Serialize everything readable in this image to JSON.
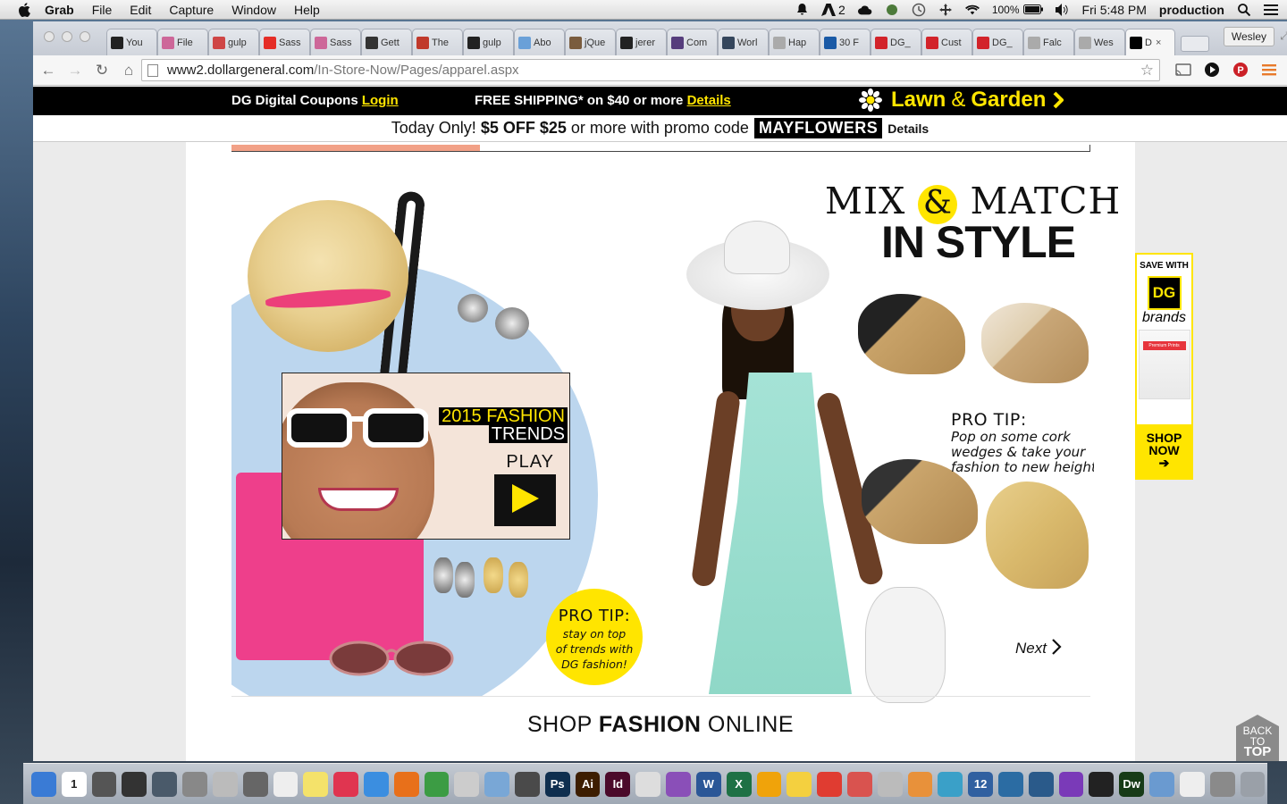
{
  "menubar": {
    "app": "Grab",
    "items": [
      "File",
      "Edit",
      "Capture",
      "Window",
      "Help"
    ],
    "adobe_count": "2",
    "battery": "100%",
    "clock": "Fri 5:48 PM",
    "user": "production"
  },
  "browser": {
    "tabs": [
      {
        "label": "You",
        "icon": "github-icon",
        "color": "#222222"
      },
      {
        "label": "File",
        "icon": "sass-icon",
        "color": "#cd6799"
      },
      {
        "label": "gulp",
        "icon": "gulp-icon",
        "color": "#cf4646"
      },
      {
        "label": "Sass",
        "icon": "youtube-icon",
        "color": "#e52d27"
      },
      {
        "label": "Sass",
        "icon": "sass-icon",
        "color": "#cd6799"
      },
      {
        "label": "Gett",
        "icon": "circle-icon",
        "color": "#333333"
      },
      {
        "label": "The",
        "icon": "zend-icon",
        "color": "#c0392b"
      },
      {
        "label": "gulp",
        "icon": "github-icon",
        "color": "#222222"
      },
      {
        "label": "Abo",
        "icon": "bird-icon",
        "color": "#6aa0d8"
      },
      {
        "label": "jQue",
        "icon": "photo-icon",
        "color": "#7a5c3e"
      },
      {
        "label": "jerer",
        "icon": "github-icon",
        "color": "#222222"
      },
      {
        "label": "Com",
        "icon": "bootstrap-icon",
        "color": "#563d7c"
      },
      {
        "label": "Worl",
        "icon": "tumblr-icon",
        "color": "#35465c"
      },
      {
        "label": "Hap",
        "icon": "page-icon",
        "color": "#aaaaaa"
      },
      {
        "label": "30 F",
        "icon": "h-icon",
        "color": "#1a5aa6"
      },
      {
        "label": "DG_",
        "icon": "pr-icon",
        "color": "#d2232a"
      },
      {
        "label": "Cust",
        "icon": "s-icon",
        "color": "#d2232a"
      },
      {
        "label": "DG_",
        "icon": "pr-icon",
        "color": "#d2232a"
      },
      {
        "label": "Falc",
        "icon": "page-icon",
        "color": "#aaaaaa"
      },
      {
        "label": "Wes",
        "icon": "page-icon",
        "color": "#aaaaaa"
      },
      {
        "label": "D",
        "icon": "dg-icon",
        "color": "#000000",
        "active": true
      }
    ],
    "profile": "Wesley",
    "url_host": "www2.dollargeneral.com",
    "url_path": "/In-Store-Now/Pages/apparel.aspx"
  },
  "topbar": {
    "coupons_text": "DG Digital Coupons",
    "login_link": "Login",
    "shipping_text": "FREE SHIPPING* on $40 or more",
    "details_link": "Details",
    "lawn": "Lawn",
    "amp": "&",
    "garden": "Garden",
    "accent": "#ffe500"
  },
  "promo": {
    "prefix": "Today Only!",
    "offer": "$5 OFF $25",
    "middle": "or more with promo code",
    "code": "MAYFLOWERS",
    "details": "Details"
  },
  "hero": {
    "progress": 0.29,
    "video": {
      "year_line": "2015 FASHION",
      "trends_line": "TRENDS",
      "play_label": "PLAY"
    },
    "tip_left": {
      "title": "PRO TIP:",
      "lines": [
        "stay on top",
        "of trends with",
        "DG fashion!"
      ]
    },
    "heading_mix": "MIX",
    "heading_amp": "&",
    "heading_match": "MATCH",
    "heading_style": "IN STYLE",
    "tip_right": {
      "title": "PRO TIP:",
      "lines": [
        "Pop on some cork",
        "wedges & take your",
        "fashion to new heights"
      ]
    },
    "next": "Next"
  },
  "shop": {
    "pre": "SHOP",
    "bold": "FASHION",
    "post": "ONLINE"
  },
  "side": {
    "save_with": "SAVE WITH",
    "logo": "DG",
    "brands": "brands",
    "product": "Premium Prints",
    "shop_now_1": "SHOP",
    "shop_now_2": "NOW",
    "arrow": "➔"
  },
  "backtop": {
    "line1": "BACK",
    "line2": "TO",
    "line3": "TOP"
  },
  "dock": [
    {
      "name": "finder-icon",
      "color": "#3a7bd5"
    },
    {
      "name": "calendar-icon",
      "color": "#ffffff",
      "text": "1"
    },
    {
      "name": "launchpad-icon",
      "color": "#555555"
    },
    {
      "name": "dashboard-icon",
      "color": "#333333"
    },
    {
      "name": "mission-control-icon",
      "color": "#4a5a6a"
    },
    {
      "name": "system-prefs-icon",
      "color": "#888888"
    },
    {
      "name": "calculator-icon",
      "color": "#bbbbbb"
    },
    {
      "name": "facetime-icon",
      "color": "#666666"
    },
    {
      "name": "textedit-icon",
      "color": "#eeeeee"
    },
    {
      "name": "stickies-icon",
      "color": "#f4e26a"
    },
    {
      "name": "itunes-icon",
      "color": "#e03550"
    },
    {
      "name": "safari-icon",
      "color": "#3b8ee0"
    },
    {
      "name": "firefox-icon",
      "color": "#e8701a"
    },
    {
      "name": "chrome-icon",
      "color": "#3c9c44"
    },
    {
      "name": "script-editor-icon",
      "color": "#cccccc"
    },
    {
      "name": "preview-icon",
      "color": "#79a7d6"
    },
    {
      "name": "sublime-icon",
      "color": "#4a4a4a"
    },
    {
      "name": "photoshop-icon",
      "color": "#0f2f4f",
      "text": "Ps"
    },
    {
      "name": "illustrator-icon",
      "color": "#3d1e00",
      "text": "Ai"
    },
    {
      "name": "indesign-icon",
      "color": "#4b0a2a",
      "text": "Id"
    },
    {
      "name": "acrobat-icon",
      "color": "#dddddd"
    },
    {
      "name": "vlc-icon",
      "color": "#8a4fb8"
    },
    {
      "name": "word-icon",
      "color": "#2b5797",
      "text": "W"
    },
    {
      "name": "excel-icon",
      "color": "#1e7145",
      "text": "X"
    },
    {
      "name": "outlook-icon",
      "color": "#f0a30a"
    },
    {
      "name": "cyberduck-icon",
      "color": "#f4d03f"
    },
    {
      "name": "acrobat-reader-icon",
      "color": "#e03c31"
    },
    {
      "name": "presentation-icon",
      "color": "#d9534f"
    },
    {
      "name": "quill-icon",
      "color": "#bbbbbb"
    },
    {
      "name": "balloon-icon",
      "color": "#e8913a"
    },
    {
      "name": "l-icon",
      "color": "#3aa0c8"
    },
    {
      "name": "clock-icon",
      "color": "#3060a0",
      "text": "12"
    },
    {
      "name": "wordpress-icon",
      "color": "#2b6ca3"
    },
    {
      "name": "network-icon",
      "color": "#2a5a8a"
    },
    {
      "name": "heart-icon",
      "color": "#7a3ab8"
    },
    {
      "name": "terminal-icon",
      "color": "#222222"
    },
    {
      "name": "dreamweaver-icon",
      "color": "#173b17",
      "text": "Dw"
    },
    {
      "name": "folder-icon",
      "color": "#6a9ad0"
    },
    {
      "name": "document-icon",
      "color": "#eeeeee"
    },
    {
      "name": "photo-stack-icon",
      "color": "#8a8a8a"
    },
    {
      "name": "trash-icon",
      "color": "#9aa0a8"
    }
  ]
}
